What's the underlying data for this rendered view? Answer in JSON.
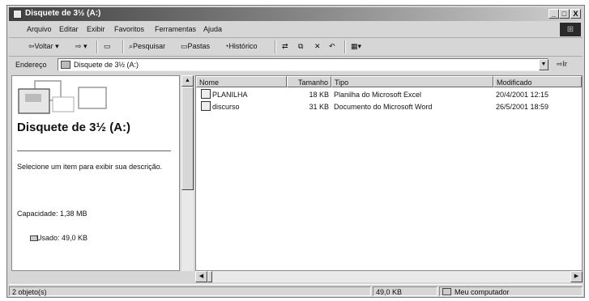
{
  "window": {
    "title": "Disquete de 3½ (A:)",
    "controls": [
      "_",
      "□",
      "X"
    ]
  },
  "menu": [
    "Arquivo",
    "Editar",
    "Exibir",
    "Favoritos",
    "Ferramentas",
    "Ajuda"
  ],
  "toolbar": {
    "back": "Voltar",
    "search": "Pesquisar",
    "folders": "Pastas",
    "history": "Histórico"
  },
  "address": {
    "label": "Endereço",
    "value": "Disquete de 3½ (A:)",
    "go": "Ir"
  },
  "left_pane": {
    "title": "Disquete de 3½ (A:)",
    "select_msg": "Selecione um item para exibir sua descrição.",
    "capacity": "Capacidade: 1,38 MB",
    "used": "Usado: 49,0 KB"
  },
  "list": {
    "columns": [
      "Nome",
      "Tamanho",
      "Tipo",
      "Modificado"
    ],
    "rows": [
      {
        "name": "PLANILHA",
        "size": "18 KB",
        "type": "Planilha do Microsoft Excel",
        "modified": "20/4/2001 12:15",
        "icon": "excel-file-icon"
      },
      {
        "name": "discurso",
        "size": "31 KB",
        "type": "Documento do Microsoft Word",
        "modified": "26/5/2001 18:59",
        "icon": "word-file-icon"
      }
    ]
  },
  "status": {
    "objects": "2 objeto(s)",
    "size": "49,0 KB",
    "location": "Meu computador"
  }
}
